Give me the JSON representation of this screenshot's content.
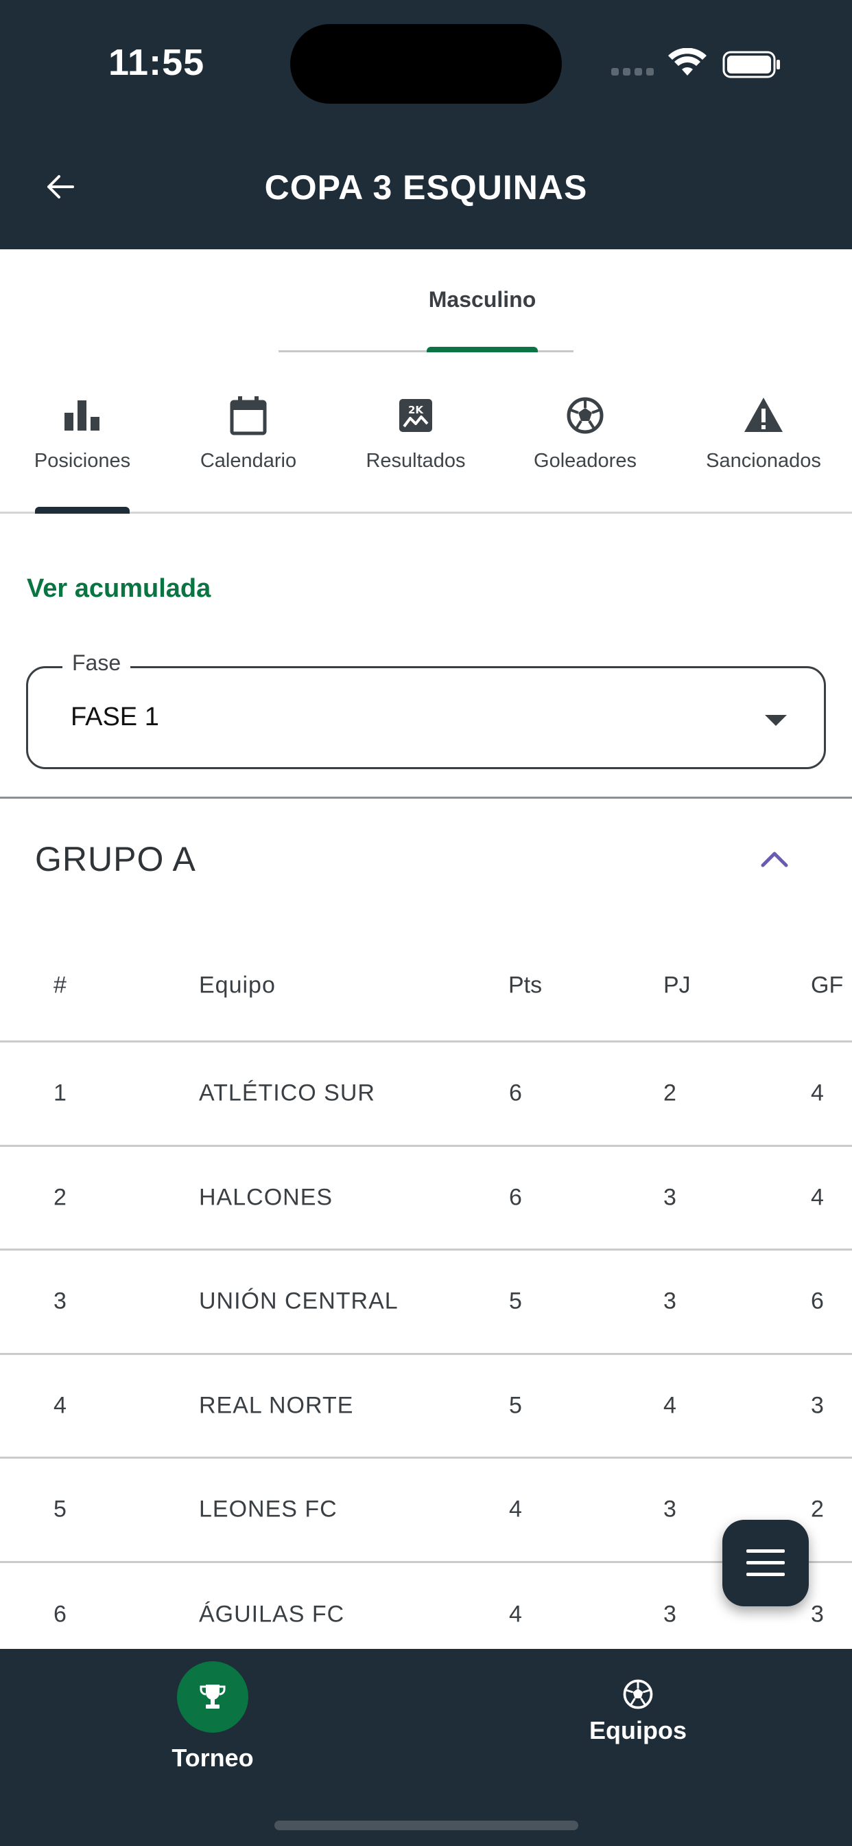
{
  "status_bar": {
    "time": "11:55"
  },
  "header": {
    "title": "COPA 3 ESQUINAS",
    "back_icon": "arrow-left-icon"
  },
  "gender_tabs": [
    {
      "label": "Masculino",
      "active": true
    }
  ],
  "section_tabs": [
    {
      "label": "Posiciones",
      "icon": "bar-chart-icon",
      "active": true
    },
    {
      "label": "Calendario",
      "icon": "calendar-icon",
      "active": false
    },
    {
      "label": "Resultados",
      "icon": "scoreboard-icon",
      "active": false
    },
    {
      "label": "Goleadores",
      "icon": "soccer-ball-icon",
      "active": false
    },
    {
      "label": "Sancionados",
      "icon": "warning-icon",
      "active": false
    }
  ],
  "accumulated_link": "Ver acumulada",
  "fase_select": {
    "label": "Fase",
    "value": "FASE 1"
  },
  "group": {
    "title": "GRUPO A",
    "columns": [
      "#",
      "Equipo",
      "Pts",
      "PJ",
      "GF"
    ],
    "rows": [
      {
        "rank": "1",
        "team": "ATLÉTICO SUR",
        "pts": "6",
        "pj": "2",
        "gf": "4"
      },
      {
        "rank": "2",
        "team": "HALCONES",
        "pts": "6",
        "pj": "3",
        "gf": "4"
      },
      {
        "rank": "3",
        "team": "UNIÓN CENTRAL",
        "pts": "5",
        "pj": "3",
        "gf": "6"
      },
      {
        "rank": "4",
        "team": "REAL NORTE",
        "pts": "5",
        "pj": "4",
        "gf": "3"
      },
      {
        "rank": "5",
        "team": "LEONES FC",
        "pts": "4",
        "pj": "3",
        "gf": "2"
      },
      {
        "rank": "6",
        "team": "ÁGUILAS FC",
        "pts": "4",
        "pj": "3",
        "gf": "3"
      }
    ]
  },
  "fab": {
    "icon": "menu-icon"
  },
  "bottom_nav": [
    {
      "label": "Torneo",
      "icon": "trophy-icon",
      "active": true
    },
    {
      "label": "Equipos",
      "icon": "soccer-ball-icon",
      "active": false
    }
  ],
  "colors": {
    "primary_dark": "#1f2d38",
    "accent_green": "#0a7443",
    "chevron_purple": "#6a5bb0"
  }
}
